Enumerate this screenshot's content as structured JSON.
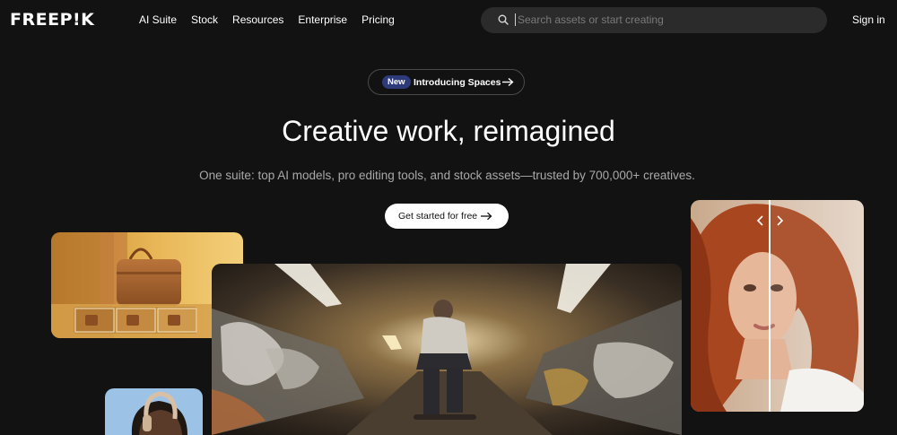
{
  "brand": {
    "logo_text": "FREEP!K"
  },
  "nav": {
    "items": [
      {
        "label": "AI Suite"
      },
      {
        "label": "Stock"
      },
      {
        "label": "Resources"
      },
      {
        "label": "Enterprise"
      },
      {
        "label": "Pricing"
      }
    ]
  },
  "search": {
    "placeholder": "Search assets or start creating",
    "value": ""
  },
  "header": {
    "signin_label": "Sign in"
  },
  "announcement": {
    "badge": "New",
    "text": "Introducing Spaces"
  },
  "hero": {
    "title": "Creative work, reimagined",
    "subtitle": "One suite: top AI models, pro editing tools, and stock assets—trusted by 700,000+ creatives.",
    "cta_label": "Get started for free"
  },
  "colors": {
    "background": "#121212",
    "search_bg": "#2b2b2b",
    "badge_bg": "#2d3b7a",
    "cta_bg": "#ffffff",
    "subtitle_text": "#a9a9a9"
  },
  "icons": {
    "search": "search-icon",
    "arrow": "arrow-right-icon",
    "compare_left": "chevron-left-icon",
    "compare_right": "chevron-right-icon"
  }
}
